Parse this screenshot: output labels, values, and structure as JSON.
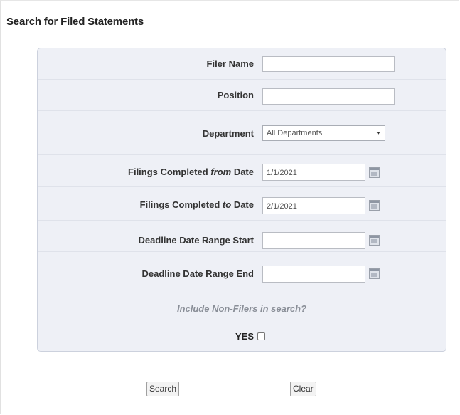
{
  "page": {
    "title": "Search for Filed Statements"
  },
  "form": {
    "filer_name": {
      "label": "Filer Name",
      "value": ""
    },
    "position": {
      "label": "Position",
      "value": ""
    },
    "department": {
      "label": "Department",
      "selected": "All Departments"
    },
    "filings_from": {
      "label_prefix": "Filings Completed ",
      "label_em": "from",
      "label_suffix": " Date",
      "value": "1/1/2021"
    },
    "filings_to": {
      "label_prefix": "Filings Completed ",
      "label_em": "to",
      "label_suffix": " Date",
      "value": "2/1/2021"
    },
    "deadline_start": {
      "label": "Deadline Date Range Start",
      "value": ""
    },
    "deadline_end": {
      "label": "Deadline Date Range End",
      "value": ""
    },
    "include_nonfilers": {
      "question": "Include Non-Filers in search?",
      "yes_label": "YES",
      "checked": false
    }
  },
  "buttons": {
    "search": "Search",
    "clear": "Clear"
  },
  "icons": {
    "calendar": "calendar-icon",
    "dropdown": "chevron-down-icon"
  }
}
